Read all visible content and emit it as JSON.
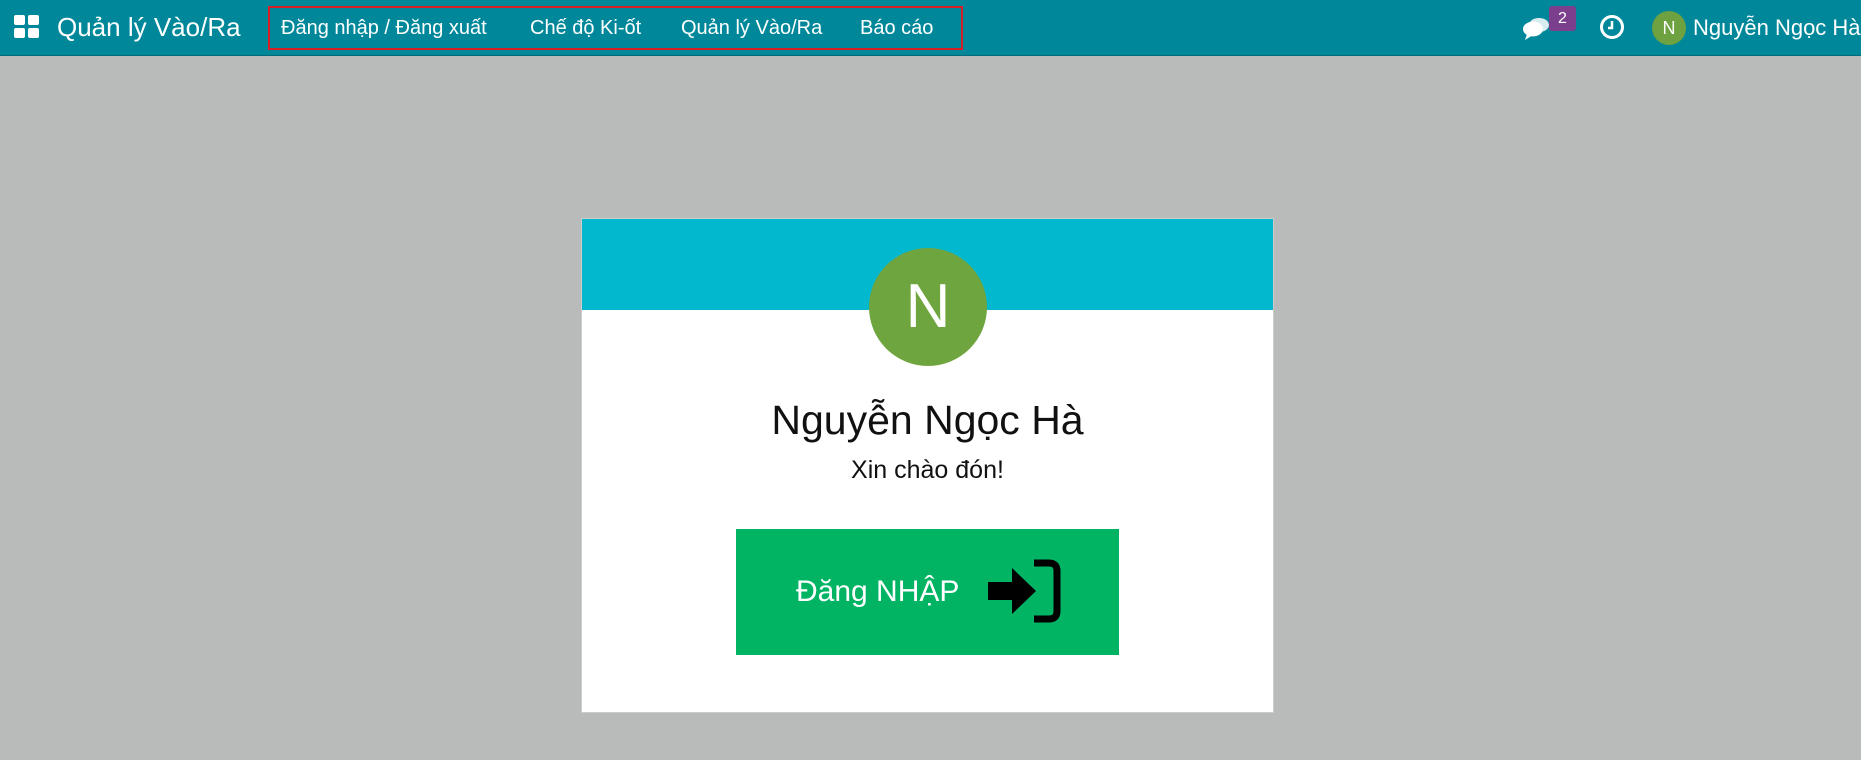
{
  "topbar": {
    "app_title": "Quản lý Vào/Ra",
    "menu": [
      {
        "label": "Đăng nhập / Đăng xuất"
      },
      {
        "label": "Chế độ Ki-ốt"
      },
      {
        "label": "Quản lý Vào/Ra"
      },
      {
        "label": "Báo cáo"
      }
    ],
    "message_badge": "2",
    "user": {
      "initial": "N",
      "name": "Nguyễn Ngọc Hà"
    }
  },
  "card": {
    "avatar_initial": "N",
    "employee_name": "Nguyễn Ngọc Hà",
    "welcome": "Xin chào đón!",
    "button_label": "Đăng NHẬP"
  },
  "colors": {
    "topbar": "#00889a",
    "card_header": "#02b8cf",
    "avatar": "#6fa53f",
    "button": "#00b464",
    "badge": "#7b3f8e",
    "highlight": "#d71f26"
  },
  "icons": [
    "apps-icon",
    "chat-icon",
    "clock-icon",
    "sign-in-icon"
  ]
}
